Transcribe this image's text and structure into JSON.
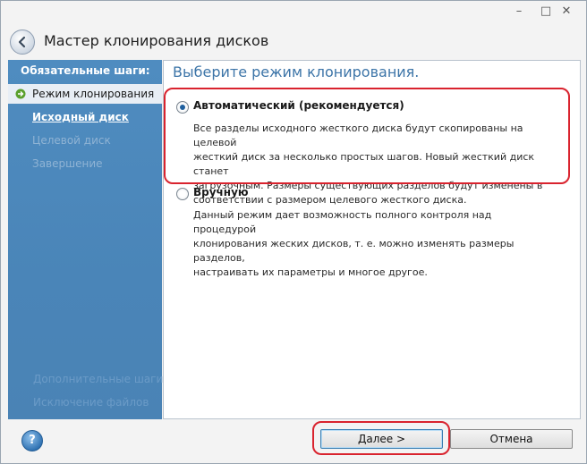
{
  "window": {
    "minimize_glyph": "–",
    "maximize_glyph": "□",
    "close_glyph": "✕"
  },
  "header": {
    "title": "Мастер клонирования дисков",
    "back_icon": "back-arrow-icon"
  },
  "sidebar": {
    "heading": "Обязательные шаги:",
    "items": [
      {
        "label": "Режим клонирования",
        "state": "active"
      },
      {
        "label": "Исходный диск",
        "state": "link"
      },
      {
        "label": "Целевой диск",
        "state": "disabled"
      },
      {
        "label": "Завершение",
        "state": "disabled"
      }
    ],
    "optional_heading": "Дополнительные шаги:",
    "optional_item": "Исключение файлов"
  },
  "content": {
    "title": "Выберите режим клонирования.",
    "options": [
      {
        "label": "Автоматический (рекомендуется)",
        "selected": true,
        "description_lines": [
          "Все разделы исходного жесткого диска будут скопированы на целевой",
          "жесткий диск за несколько простых шагов. Новый жесткий диск станет",
          "загрузочным. Размеры существующих разделов будут изменены в",
          "соответствии с размером целевого жесткого диска."
        ]
      },
      {
        "label": "Вручную",
        "selected": false,
        "description_lines": [
          "Данный режим дает возможность полного контроля над процедурой",
          "клонирования жеских дисков, т. е. можно изменять размеры разделов,",
          "настраивать их параметры и многое другое."
        ]
      }
    ]
  },
  "footer": {
    "help_glyph": "?",
    "next_label_underlined": "Д",
    "next_label_rest": "алее >",
    "cancel_label": "Отмена"
  },
  "colors": {
    "sidebar": "#4b86b8",
    "title_accent": "#3d75a8",
    "highlight": "#d9232e"
  }
}
